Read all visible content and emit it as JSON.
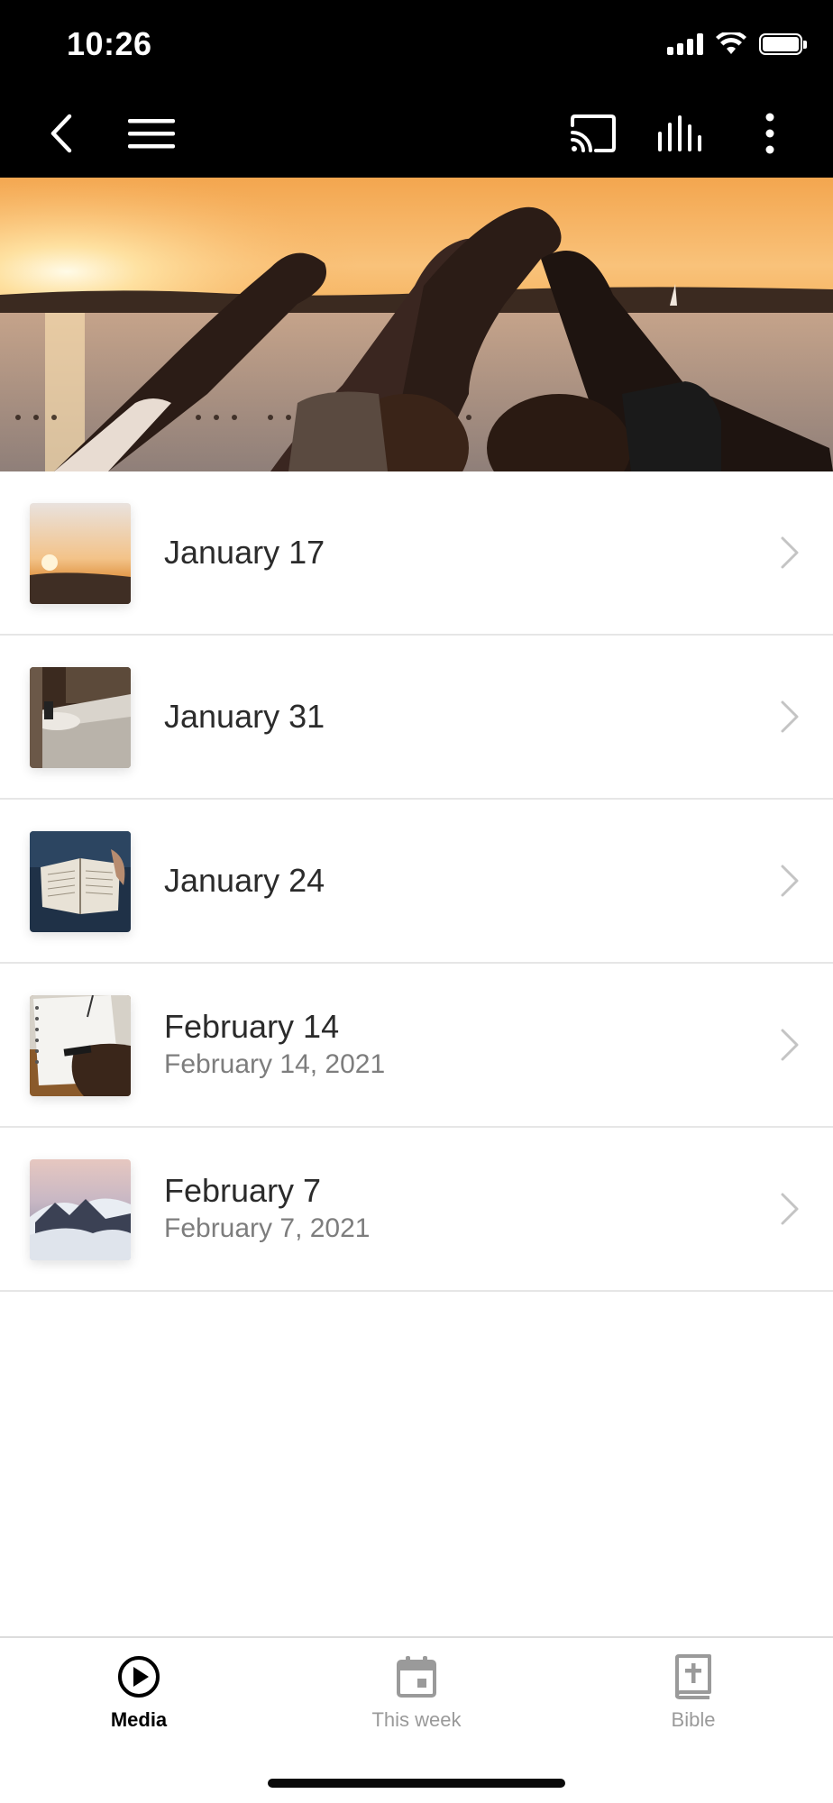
{
  "status_bar": {
    "time": "10:26"
  },
  "nav": {
    "back_icon": "chevron-left-icon",
    "menu_icon": "hamburger-icon",
    "cast_icon": "cast-icon",
    "audio_icon": "equalizer-icon",
    "more_icon": "more-vertical-icon"
  },
  "hero": {
    "image": "hands-forming-hearts-at-sunset-banner"
  },
  "list": {
    "items": [
      {
        "title": "January 17",
        "subtitle": "",
        "thumb": "sunset-horizon-thumbnail"
      },
      {
        "title": "January 31",
        "subtitle": "",
        "thumb": "living-room-table-thumbnail"
      },
      {
        "title": "January 24",
        "subtitle": "",
        "thumb": "open-bible-thumbnail"
      },
      {
        "title": "February 14",
        "subtitle": "February 14, 2021",
        "thumb": "notebook-writing-thumbnail"
      },
      {
        "title": "February 7",
        "subtitle": "February 7, 2021",
        "thumb": "mountain-clouds-thumbnail"
      }
    ]
  },
  "tabs": [
    {
      "label": "Media",
      "icon": "play-circle-icon",
      "active": true
    },
    {
      "label": "This week",
      "icon": "calendar-icon",
      "active": false
    },
    {
      "label": "Bible",
      "icon": "bible-icon",
      "active": false
    }
  ],
  "colors": {
    "header_bg": "#000000",
    "active_tab": "#000000",
    "inactive_tab": "#9a9a9a",
    "divider": "#e6e6e6"
  }
}
